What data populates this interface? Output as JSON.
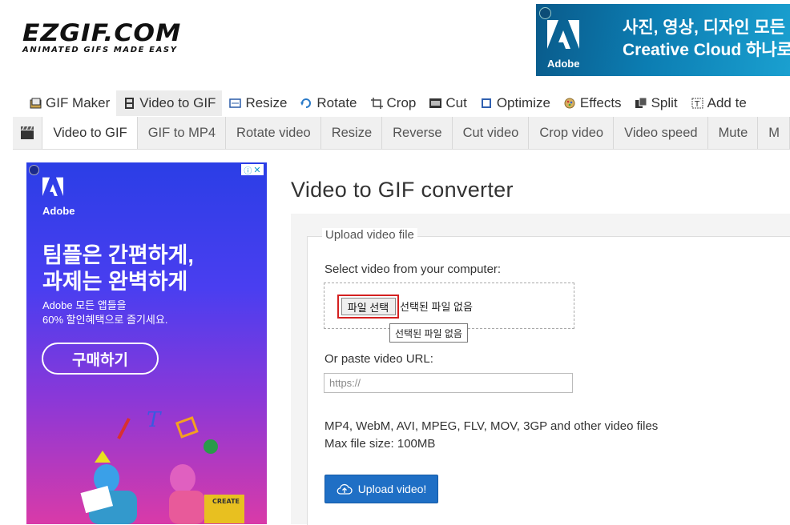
{
  "logo": {
    "main": "EZGIF.COM",
    "tagline": "ANIMATED GIFS MADE EASY"
  },
  "banner_ad": {
    "brand": "Adobe",
    "line1": "사진, 영상, 디자인 모든 것",
    "line2": "Creative Cloud 하나로!"
  },
  "main_nav": [
    {
      "label": "GIF Maker",
      "icon": "gif-maker-icon"
    },
    {
      "label": "Video to GIF",
      "icon": "film-icon",
      "active": true
    },
    {
      "label": "Resize",
      "icon": "resize-icon"
    },
    {
      "label": "Rotate",
      "icon": "rotate-icon"
    },
    {
      "label": "Crop",
      "icon": "crop-icon"
    },
    {
      "label": "Cut",
      "icon": "cut-icon"
    },
    {
      "label": "Optimize",
      "icon": "optimize-icon"
    },
    {
      "label": "Effects",
      "icon": "effects-icon"
    },
    {
      "label": "Split",
      "icon": "split-icon"
    },
    {
      "label": "Add te",
      "icon": "add-text-icon"
    }
  ],
  "sub_nav": [
    {
      "label": "Video to GIF",
      "active": true
    },
    {
      "label": "GIF to MP4"
    },
    {
      "label": "Rotate video"
    },
    {
      "label": "Resize"
    },
    {
      "label": "Reverse"
    },
    {
      "label": "Cut video"
    },
    {
      "label": "Crop video"
    },
    {
      "label": "Video speed"
    },
    {
      "label": "Mute"
    },
    {
      "label": "M"
    }
  ],
  "left_ad": {
    "brand": "Adobe",
    "headline1": "팀플은 간편하게,",
    "headline2": "과제는 완벽하게",
    "body1": "Adobe 모든 앱들을",
    "body2": "60% 할인혜택으로 즐기세요.",
    "cta": "구매하기"
  },
  "page": {
    "title": "Video to GIF converter",
    "legend": "Upload video file",
    "select_label": "Select video from your computer:",
    "file_button": "파일 선택",
    "file_status": "선택된 파일 없음",
    "tooltip": "선택된 파일 없음",
    "url_label": "Or paste video URL:",
    "url_placeholder": "https://",
    "formats": "MP4, WebM, AVI, MPEG, FLV, MOV, 3GP and other video files",
    "max_size": "Max file size: 100MB",
    "upload_button": "Upload video!"
  },
  "colors": {
    "upload_button": "#1f6fc5",
    "highlight": "#d42020"
  }
}
